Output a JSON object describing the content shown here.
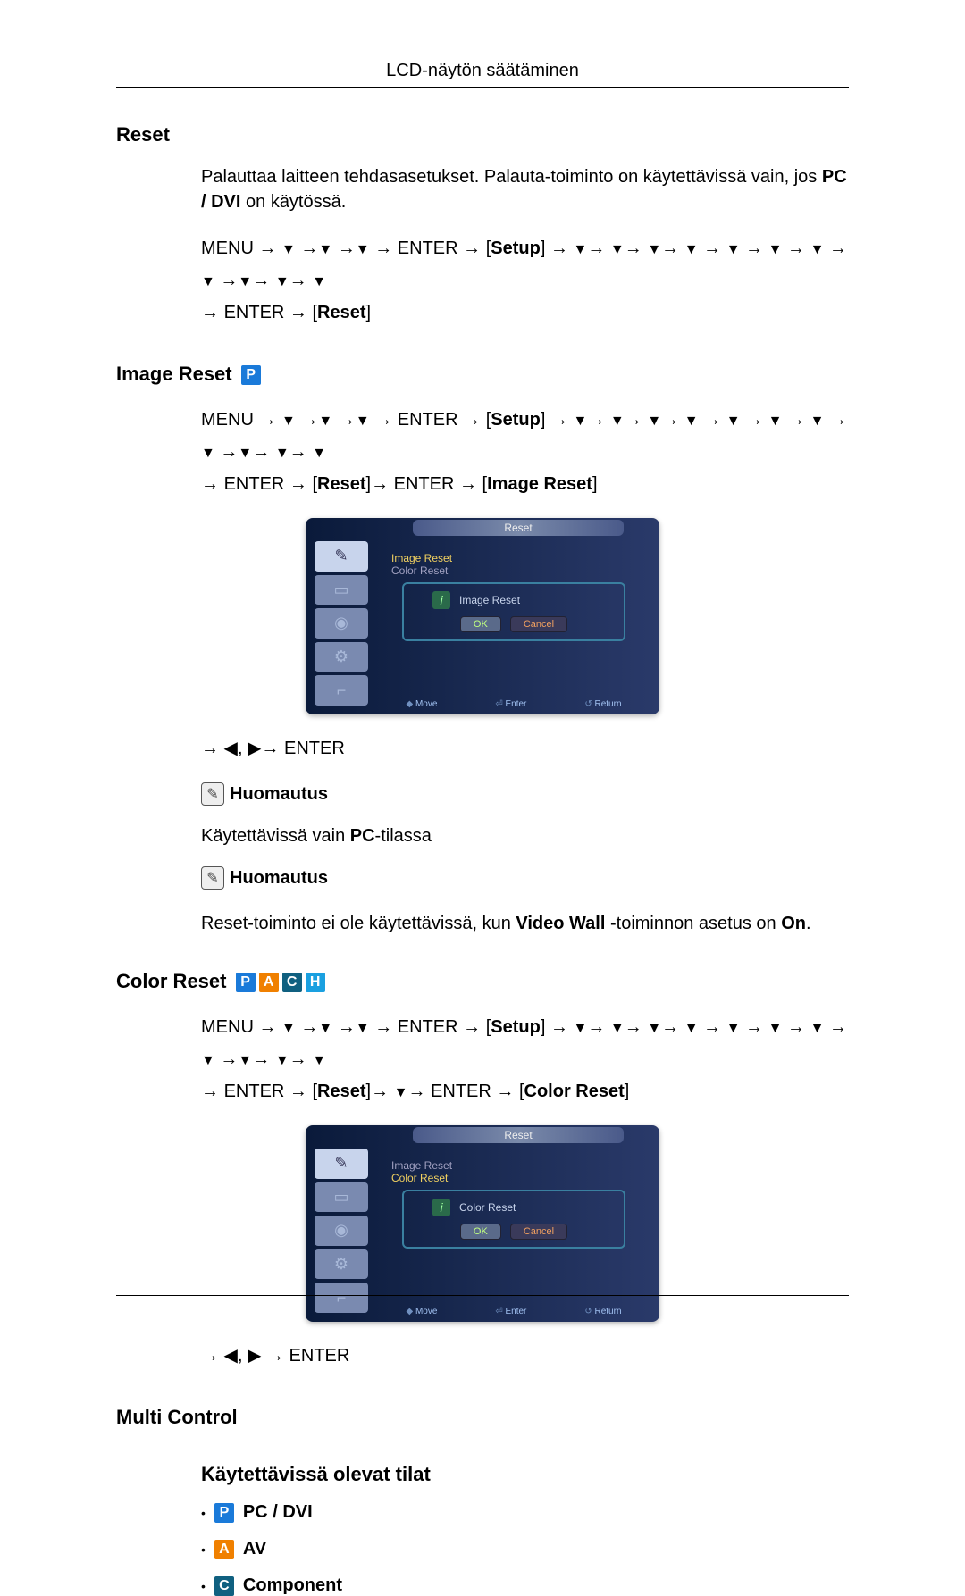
{
  "header": {
    "title": "LCD-näytön säätäminen"
  },
  "reset": {
    "heading": "Reset",
    "desc_prefix": "Palauttaa laitteen tehdasasetukset. Palauta-toiminto on käytettävissä vain, jos ",
    "desc_bold": "PC / DVI",
    "desc_suffix": " on käytössä.",
    "seq_menu": "MENU",
    "seq_enter": "ENTER",
    "seq_setup": "Setup",
    "seq_reset": "Reset"
  },
  "image_reset": {
    "heading": "Image Reset",
    "seq_image_reset": "Image Reset",
    "nav_tail": "→ ◀, ▶→ ENTER",
    "note_icon_name": "pencil-note-icon",
    "note1": "Huomautus",
    "note1_text_prefix": "Käytettävissä vain ",
    "note1_text_bold": "PC",
    "note1_text_suffix": "-tilassa",
    "note2": "Huomautus",
    "note2_text_prefix": "Reset-toiminto ei ole käytettävissä, kun ",
    "note2_text_bold": "Video Wall",
    "note2_text_mid": " -toiminnon asetus on ",
    "note2_text_bold2": "On",
    "note2_text_suffix": "."
  },
  "color_reset": {
    "heading": "Color Reset",
    "seq_color_reset": "Color Reset",
    "nav_tail": "→ ◀, ▶ → ENTER"
  },
  "multi_control": {
    "heading": "Multi Control",
    "modes_heading": "Käytettävissä olevat tilat",
    "modes": [
      {
        "badge": "P",
        "badge_class": "badge-p",
        "label": "PC / DVI"
      },
      {
        "badge": "A",
        "badge_class": "badge-a",
        "label": "AV"
      },
      {
        "badge": "C",
        "badge_class": "badge-c",
        "label": "Component"
      }
    ]
  },
  "osd1": {
    "title": "Reset",
    "list": [
      "Image Reset",
      "Color Reset"
    ],
    "dialog_title": "Image Reset",
    "ok": "OK",
    "cancel": "Cancel",
    "footer": {
      "move": "Move",
      "enter": "Enter",
      "return": "Return"
    }
  },
  "osd2": {
    "title": "Reset",
    "list": [
      "Image Reset",
      "Color Reset"
    ],
    "dialog_title": "Color Reset",
    "ok": "OK",
    "cancel": "Cancel",
    "footer": {
      "move": "Move",
      "enter": "Enter",
      "return": "Return"
    }
  },
  "badges": {
    "p": "P",
    "a": "A",
    "c": "C",
    "h": "H"
  }
}
